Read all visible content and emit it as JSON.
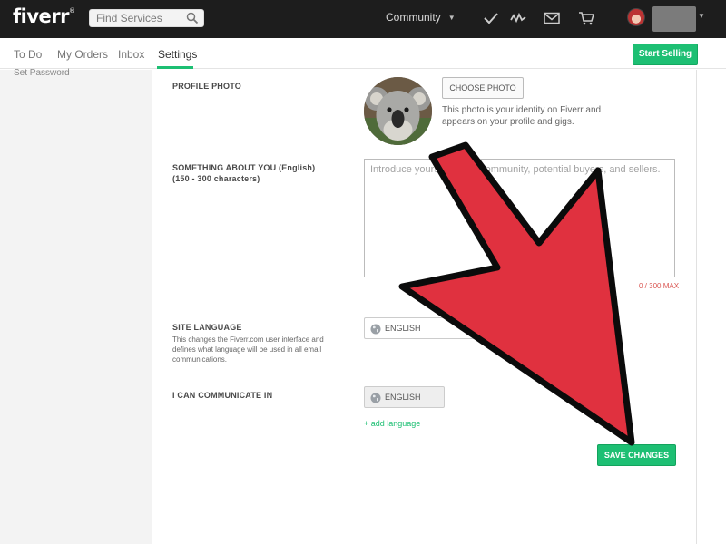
{
  "header": {
    "logo": "fiverr",
    "logo_mark": "®",
    "search_placeholder": "Find Services",
    "community_label": "Community"
  },
  "subnav": {
    "tabs": [
      {
        "label": "To Do"
      },
      {
        "label": "My Orders"
      },
      {
        "label": "Inbox"
      },
      {
        "label": "Settings",
        "active": true
      }
    ],
    "start_selling": "Start Selling"
  },
  "sidebar": {
    "items": [
      {
        "label": "Set Password"
      }
    ]
  },
  "settings": {
    "profile_photo": {
      "label": "PROFILE PHOTO",
      "button": "CHOOSE PHOTO",
      "note": "This photo is your identity on Fiverr and appears on your profile and gigs."
    },
    "about": {
      "label": "SOMETHING ABOUT YOU (English)",
      "sublabel": "(150 - 300 characters)",
      "placeholder": "Introduce yourself to the community, potential buyers, and sellers.",
      "value": "",
      "counter": "0 / 300 MAX"
    },
    "site_language": {
      "label": "SITE LANGUAGE",
      "description": "This changes the Fiverr.com user interface and defines what language will be used in all email communications.",
      "selected": "ENGLISH"
    },
    "communicate": {
      "label": "I CAN COMMUNICATE IN",
      "languages": [
        "ENGLISH"
      ],
      "add_link": "+ add language"
    },
    "save_button": "SAVE CHANGES"
  },
  "colors": {
    "accent_green": "#1dbf73",
    "topbar": "#1d1d1d",
    "annotation_arrow": "#e0313f"
  }
}
